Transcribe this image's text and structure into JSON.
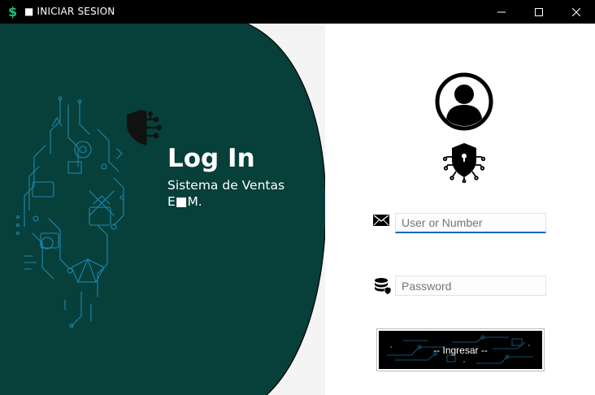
{
  "window": {
    "title": "■ INICIAR SESION",
    "app_icon": "dollar-icon",
    "controls": [
      "minimize-icon",
      "maximize-icon",
      "close-icon"
    ]
  },
  "hero": {
    "title": "Log In",
    "subtitle_line1": "Sistema de Ventas",
    "subtitle_line2": "E■M.",
    "background_color": "#073f3a",
    "icon": "shield-circuit-icon"
  },
  "form": {
    "avatar_icon": "user-avatar-icon",
    "security_icon": "shield-circuit-icon",
    "username": {
      "value": "",
      "placeholder": "User or Number",
      "icon": "envelope-icon"
    },
    "password": {
      "value": "",
      "placeholder": "Password",
      "icon": "database-shield-icon"
    },
    "submit_label": "-- Ingresar --",
    "accent_color": "#1565c0"
  }
}
